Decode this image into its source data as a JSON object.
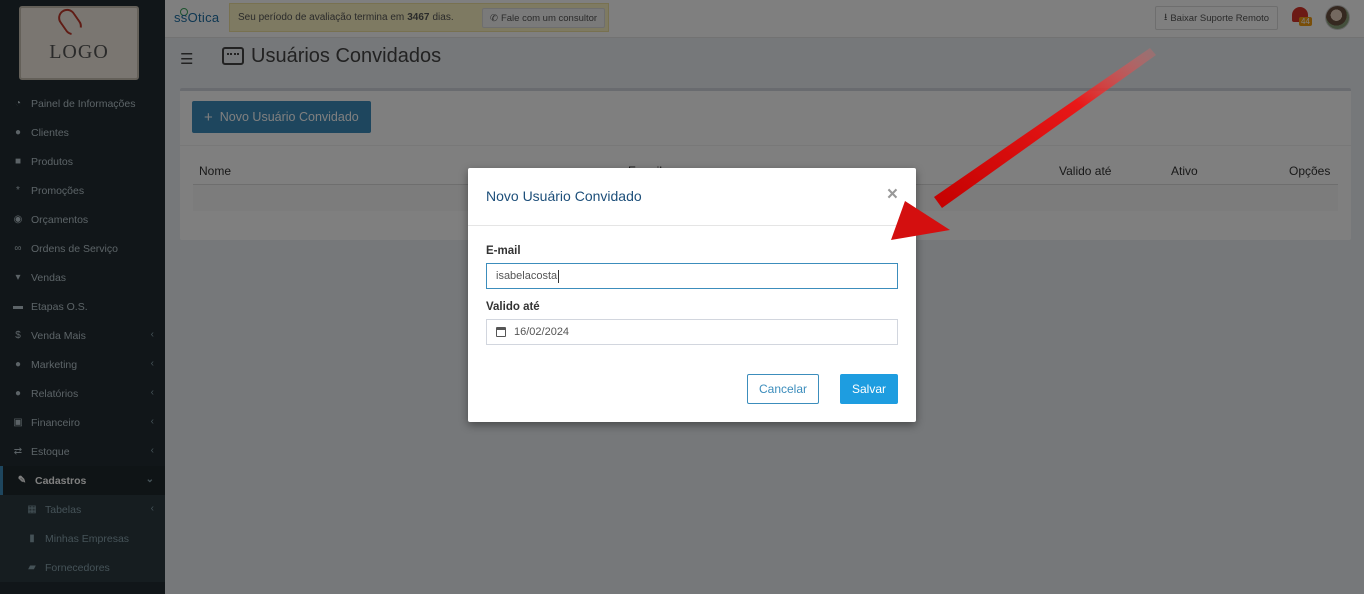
{
  "logo_text": "LOGO",
  "topbar": {
    "brand": "ssOtica",
    "trial_prefix": "Seu período de avaliação termina em",
    "trial_days": "3467",
    "trial_suffix": "dias.",
    "consult_label": "Fale com um consultor",
    "support_label": "Baixar Suporte Remoto",
    "notification_count": "44"
  },
  "sidebar": {
    "items": [
      {
        "label": "Painel de Informações",
        "icon": "dashboard-icon"
      },
      {
        "label": "Clientes",
        "icon": "users-icon"
      },
      {
        "label": "Produtos",
        "icon": "cart-icon"
      },
      {
        "label": "Promoções",
        "icon": "asterisk-icon"
      },
      {
        "label": "Orçamentos",
        "icon": "money-icon"
      },
      {
        "label": "Ordens de Serviço",
        "icon": "glasses-icon"
      },
      {
        "label": "Vendas",
        "icon": "basket-icon"
      },
      {
        "label": "Etapas O.S.",
        "icon": "card-icon"
      },
      {
        "label": "Venda Mais",
        "icon": "dollar-icon"
      },
      {
        "label": "Marketing",
        "icon": "chat-icon"
      },
      {
        "label": "Relatórios",
        "icon": "chart-icon"
      },
      {
        "label": "Financeiro",
        "icon": "cash-icon"
      },
      {
        "label": "Estoque",
        "icon": "exchange-icon"
      },
      {
        "label": "Cadastros",
        "icon": "edit-icon"
      },
      {
        "label": "Tabelas",
        "icon": "table-icon"
      },
      {
        "label": "Minhas Empresas",
        "icon": "building-icon"
      },
      {
        "label": "Fornecedores",
        "icon": "truck-icon"
      }
    ]
  },
  "page": {
    "title": "Usuários Convidados",
    "new_button": "Novo Usuário Convidado",
    "columns": [
      "Nome",
      "E-mail",
      "Valido até",
      "Ativo",
      "Opções"
    ]
  },
  "modal": {
    "title": "Novo Usuário Convidado",
    "close": "×",
    "email_label": "E-mail",
    "email_value": "isabelacosta",
    "valid_label": "Valido até",
    "valid_value": "16/02/2024",
    "cancel_label": "Cancelar",
    "save_label": "Salvar"
  },
  "colors": {
    "sidebar_bg": "#222d32",
    "primary": "#3c8dbc",
    "save_button": "#1e9de0",
    "annotation_arrow": "#e01010"
  }
}
